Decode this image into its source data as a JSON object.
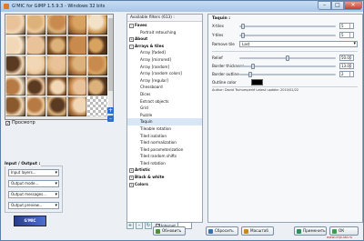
{
  "window": {
    "title": "G'MIC for GIMP 1.5.9.3 - Windows 32 bits",
    "min_label": "–",
    "max_label": "□",
    "close_label": "✕"
  },
  "preview": {
    "checkbox_label": "Просмотр",
    "zoom_in_label": "+",
    "zoom_out_label": "–"
  },
  "io": {
    "title": "Input / Output :",
    "selects": [
      "Input layers...",
      "Output mode...",
      "Output messages...",
      "Output preview..."
    ]
  },
  "logo_text": "G'MIC",
  "filters": {
    "header": "Available filters (613) :",
    "items": [
      {
        "label": "Faves",
        "kind": "cat",
        "expander": "–"
      },
      {
        "label": "Portrait retouching",
        "kind": "child"
      },
      {
        "label": "About",
        "kind": "cat",
        "expander": "+"
      },
      {
        "label": "Arrays & tiles",
        "kind": "cat",
        "expander": "–"
      },
      {
        "label": "Array [faded]",
        "kind": "child"
      },
      {
        "label": "Array [mirrored]",
        "kind": "child"
      },
      {
        "label": "Array [random]",
        "kind": "child"
      },
      {
        "label": "Array [random colors]",
        "kind": "child"
      },
      {
        "label": "Array [regular]",
        "kind": "child"
      },
      {
        "label": "Chessboard",
        "kind": "child"
      },
      {
        "label": "Dices",
        "kind": "child"
      },
      {
        "label": "Extract objects",
        "kind": "child"
      },
      {
        "label": "Grid",
        "kind": "child"
      },
      {
        "label": "Puzzle",
        "kind": "child"
      },
      {
        "label": "Taquin",
        "kind": "child",
        "selected": true
      },
      {
        "label": "Tileable rotation",
        "kind": "child"
      },
      {
        "label": "Tiled isolation",
        "kind": "child"
      },
      {
        "label": "Tiled normalization",
        "kind": "child"
      },
      {
        "label": "Tiled parameterization",
        "kind": "child"
      },
      {
        "label": "Tiled random shifts",
        "kind": "child"
      },
      {
        "label": "Tiled rotation",
        "kind": "child"
      },
      {
        "label": "Artistic",
        "kind": "cat",
        "expander": "+"
      },
      {
        "label": "Black & white",
        "kind": "cat",
        "expander": "+"
      },
      {
        "label": "Colors",
        "kind": "cat",
        "expander": "+"
      }
    ],
    "internet_label": "Internet"
  },
  "params": {
    "title": "Taquin :",
    "x_tiles": {
      "label": "X-tiles",
      "value": "5",
      "fraction": 0.02
    },
    "y_tiles": {
      "label": "Y-tiles",
      "value": "5",
      "fraction": 0.02
    },
    "remove_tile": {
      "label": "Remove tile",
      "value": "Last"
    },
    "relief": {
      "label": "Relief",
      "value": "50.00",
      "fraction": 0.5
    },
    "border_thickness": {
      "label": "Border thickness",
      "value": "13.00",
      "fraction": 0.13
    },
    "border_outline": {
      "label": "Border outline",
      "value": "2",
      "fraction": 0.1
    },
    "outline_color": {
      "label": "Outline color",
      "value": "#000000"
    },
    "author": "Author: David Tschumperlé      Latest update: 2010/01/22"
  },
  "buttons": {
    "update": "Обновить",
    "reset": "Сбросить",
    "maximize": "Масштаб",
    "apply": "Применить",
    "ok": "ОК",
    "cancel": "Отмена"
  },
  "watermark": "www.chip-lab.ru"
}
